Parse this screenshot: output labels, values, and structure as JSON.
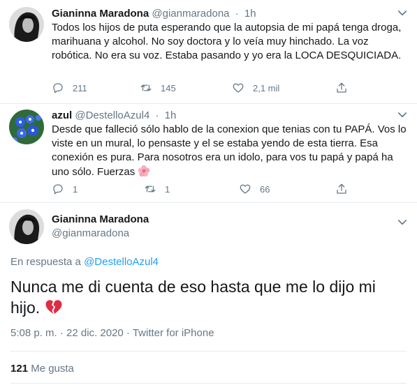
{
  "tweets": [
    {
      "display_name": "Gianinna Maradona",
      "handle": "@gianmaradona",
      "time": "1h",
      "text": "Todos los hijos de puta esperando que la autopsia de mi papá tenga droga, marihuana y alcohol. No soy doctora y lo veía muy hinchado. La voz robótica. No era su voz. Estaba pasando y yo era la LOCA DESQUICIADA.",
      "replies": "211",
      "retweets": "145",
      "likes": "2,1 mil"
    },
    {
      "display_name": "azul",
      "handle": "@DestelloAzul4",
      "time": "1h",
      "text": "Desde que falleció sólo hablo de la conexion que tenias con tu PAPÁ. Vos lo viste en un mural, lo pensaste y el se estaba yendo de esta tierra. Esa conexión es pura. Para nosotros era un idolo, para vos tu papá y papá ha uno sólo. Fuerzas",
      "emoji_icon": "hibiscus-flower-icon",
      "replies": "1",
      "retweets": "1",
      "likes": "66"
    }
  ],
  "main_tweet": {
    "display_name": "Gianinna Maradona",
    "handle": "@gianmaradona",
    "reply_prefix": "En respuesta a",
    "reply_to": "@DestelloAzul4",
    "text": "Nunca me di cuenta de eso hasta que me lo dijo mi hijo.",
    "emoji_icon": "broken-heart-icon",
    "timestamp": "5:08 p. m. · 22 dic. 2020 · Twitter for iPhone",
    "like_count": "121",
    "like_label": "Me gusta"
  },
  "colors": {
    "text": "#14171a",
    "secondary": "#657786",
    "link": "#1da1f2",
    "divider": "#e6ecf0",
    "broken_heart": "#dd2e44",
    "hibiscus": "#f4a5b8"
  }
}
